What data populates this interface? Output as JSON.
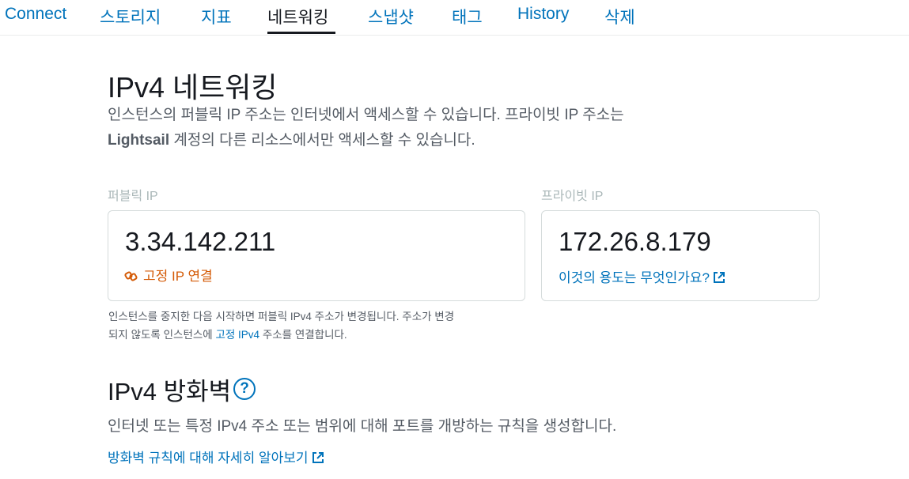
{
  "tabs": [
    {
      "label": "Connect"
    },
    {
      "label": "스토리지"
    },
    {
      "label": "지표"
    },
    {
      "label": "네트워킹",
      "active": true
    },
    {
      "label": "스냅샷"
    },
    {
      "label": "태그"
    },
    {
      "label": "History"
    },
    {
      "label": "삭제"
    }
  ],
  "networking": {
    "title": "IPv4 네트워킹",
    "desc_part1": "인스턴스의 퍼블릭 IP 주소는 인터넷에서 액세스할 수 있습니다. 프라이빗 IP 주소는",
    "desc_part2_bold": "Lightsail",
    "desc_part2_rest": " 계정의 다른 리소스에서만 액세스할 수 있습니다.",
    "public_ip_label": "퍼블릭 IP",
    "public_ip_value": "3.34.142.211",
    "attach_static_ip_link": "고정 IP 연결",
    "private_ip_label": "프라이빗 IP",
    "private_ip_value": "172.26.8.179",
    "private_ip_help_link": "이것의 용도는 무엇인가요?",
    "note_part1": "인스턴스를 중지한 다음 시작하면 퍼블릭 IPv4 주소가 변경됩니다. 주소가 변경",
    "note_part2": "되지 않도록 인스턴스에 ",
    "note_link": "고정 IPv4",
    "note_part3": " 주소를 연결합니다."
  },
  "firewall": {
    "title": "IPv4 방화벽",
    "help_symbol": "?",
    "desc": "인터넷 또는 특정 IPv4 주소 또는 범위에 대해 포트를 개방하는 규칙을 생성합니다.",
    "learn_more_link": "방화벽 규칙에 대해 자세히 알아보기"
  },
  "colors": {
    "link": "#0073bb",
    "static_ip": "#d45b07",
    "text": "#16191f",
    "muted": "#545b64",
    "label": "#aab7b8"
  }
}
